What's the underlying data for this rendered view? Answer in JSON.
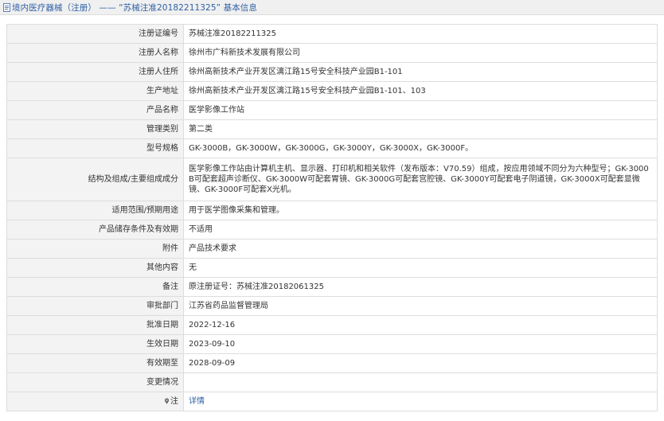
{
  "header": {
    "title": "境内医疗器械（注册） —— “苏械注准20182211325” 基本信息",
    "icon": "document-icon"
  },
  "rows": [
    {
      "label": "注册证编号",
      "value": "苏械注准20182211325"
    },
    {
      "label": "注册人名称",
      "value": "徐州市广科新技术发展有限公司"
    },
    {
      "label": "注册人住所",
      "value": "徐州高新技术产业开发区漓江路15号安全科技产业园B1-101"
    },
    {
      "label": "生产地址",
      "value": "徐州高新技术产业开发区漓江路15号安全科技产业园B1-101、103"
    },
    {
      "label": "产品名称",
      "value": "医学影像工作站"
    },
    {
      "label": "管理类别",
      "value": "第二类"
    },
    {
      "label": "型号规格",
      "value": "GK-3000B，GK-3000W，GK-3000G，GK-3000Y，GK-3000X，GK-3000F。"
    },
    {
      "label": "结构及组成/主要组成成分",
      "value": "医学影像工作站由计算机主机、显示器、打印机和相关软件（发布版本：V70.59）组成，按应用领域不同分为六种型号；GK-3000B可配套超声诊断仪、GK-3000W可配套胃镜、GK-3000G可配套宫腔镜、GK-3000Y可配套电子阴道镜，GK-3000X可配套显微镜、GK-3000F可配套X光机。"
    },
    {
      "label": "适用范围/预期用途",
      "value": "用于医学图像采集和管理。"
    },
    {
      "label": "产品储存条件及有效期",
      "value": "不适用"
    },
    {
      "label": "附件",
      "value": "产品技术要求"
    },
    {
      "label": "其他内容",
      "value": "无"
    },
    {
      "label": "备注",
      "value": "原注册证号：苏械注准20182061325"
    },
    {
      "label": "审批部门",
      "value": "江苏省药品监督管理局"
    },
    {
      "label": "批准日期",
      "value": "2022-12-16"
    },
    {
      "label": "生效日期",
      "value": "2023-09-10"
    },
    {
      "label": "有效期至",
      "value": "2028-09-09"
    },
    {
      "label": "变更情况",
      "value": ""
    }
  ],
  "note_row": {
    "label": "注",
    "icon": "location-pin-icon",
    "link": "详情"
  },
  "colors": {
    "link": "#2e5fa4",
    "label_bg": "#f3f3f3",
    "border": "#dddddd",
    "header_bg": "#f0f0f0"
  }
}
